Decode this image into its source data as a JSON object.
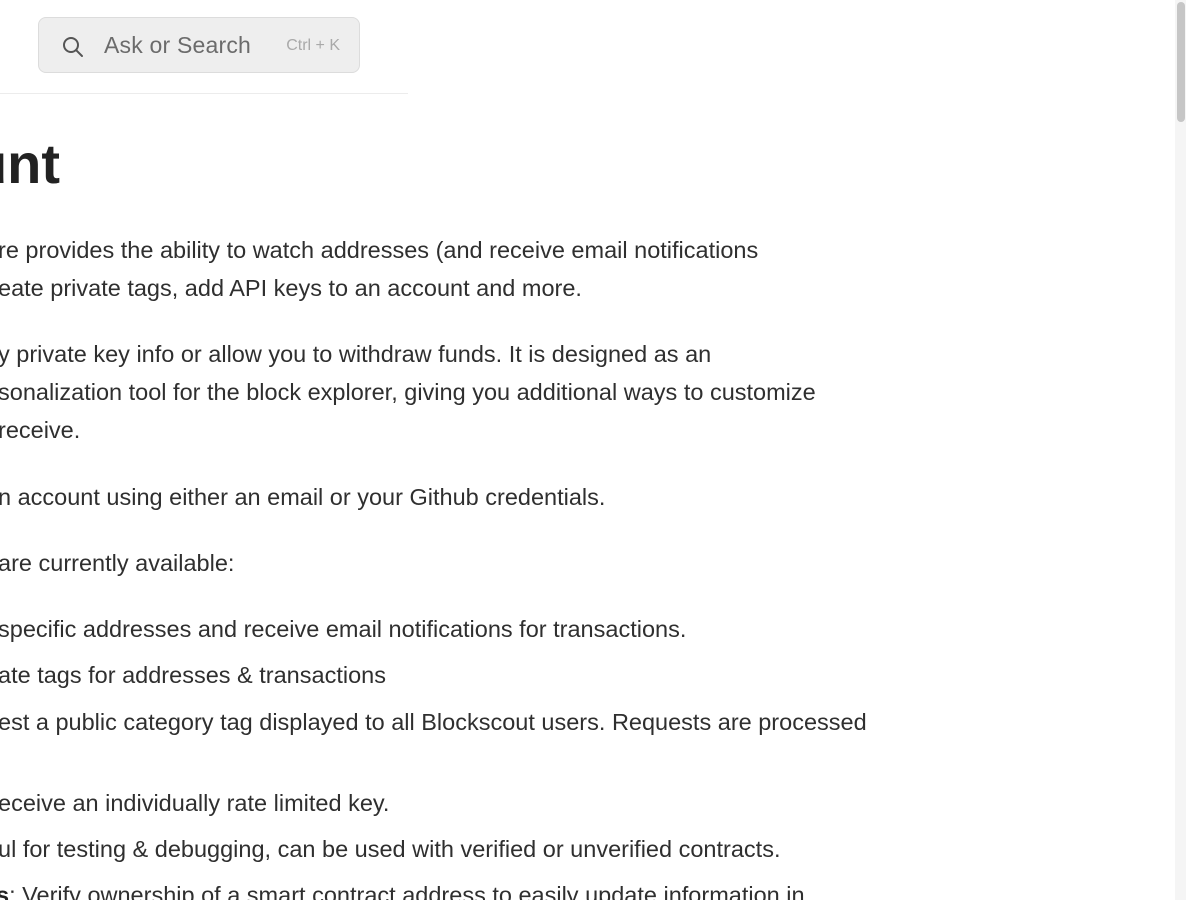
{
  "search": {
    "placeholder": "Ask or Search",
    "shortcut": "Ctrl + K"
  },
  "article": {
    "title_fragment": "unt",
    "paragraph_1": [
      "re provides the ability to watch addresses (and receive email notifications",
      "eate private tags, add API keys to an account and more."
    ],
    "paragraph_2": [
      "y private key info or allow you to withdraw funds. It is designed as an",
      "sonalization tool for the block explorer, giving you additional ways to customize",
      "receive."
    ],
    "paragraph_3": "n account using either an email or your Github credentials.",
    "paragraph_4": " are currently available:",
    "list_items": [
      "specific addresses and receive email notifications for transactions.",
      "ate tags for addresses & transactions",
      "est a public category tag displayed to all Blockscout users. Requests are processed",
      "eceive an individually rate limited key.",
      "ul for testing & debugging, can be used with verified or unverified contracts."
    ],
    "last_item": {
      "bold": "s",
      "rest": ": Verify ownership of a smart contract address to easily update information in"
    }
  }
}
